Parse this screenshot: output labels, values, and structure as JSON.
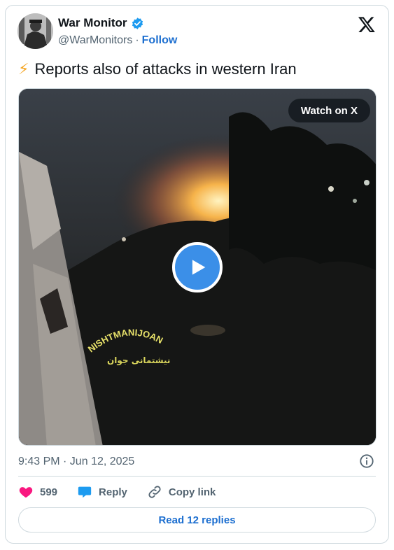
{
  "author": {
    "display_name": "War Monitor",
    "handle": "@WarMonitors",
    "separator": "·",
    "follow_label": "Follow",
    "verified": true
  },
  "tweet": {
    "emoji": "⚡",
    "text": "Reports also of attacks in western Iran"
  },
  "media": {
    "watch_label": "Watch on X",
    "watermark_text": "NISHTMANIJOAN",
    "watermark_subtext": "نیشتمانی جوان"
  },
  "meta": {
    "timestamp": "9:43 PM · Jun 12, 2025"
  },
  "actions": {
    "likes_count": "599",
    "reply_label": "Reply",
    "copy_link_label": "Copy link"
  },
  "read_replies_label": "Read 12 replies",
  "colors": {
    "accent": "#1d9bf0",
    "link": "#1d6fd0",
    "heart": "#f91880",
    "muted": "#536471"
  }
}
